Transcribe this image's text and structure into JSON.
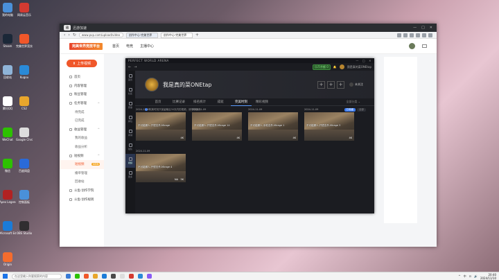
{
  "desktop": {
    "icons": [
      {
        "label": "我的电脑",
        "color": "#4a90d9"
      },
      {
        "label": "网易云音乐",
        "color": "#d33a31"
      },
      {
        "label": "Steam",
        "color": "#1b2838"
      },
      {
        "label": "完美世界竞技平台",
        "color": "#f0572a"
      },
      {
        "label": "回收站",
        "color": "#8fb4d8"
      },
      {
        "label": "Kugou",
        "color": "#2a8ad8"
      },
      {
        "label": "腾讯QQ",
        "color": "#ffffff"
      },
      {
        "label": "CS2",
        "color": "#e8a62c"
      },
      {
        "label": "WeChat",
        "color": "#2dc100"
      },
      {
        "label": "Google Chrome",
        "color": "#dddddd"
      },
      {
        "label": "微信",
        "color": "#2dc100"
      },
      {
        "label": "百度网盘",
        "color": "#2a6ad8"
      },
      {
        "label": "Apex Legends",
        "color": "#b22222"
      },
      {
        "label": "控制面板",
        "color": "#4a90d9"
      },
      {
        "label": "Microsoft Edge",
        "color": "#1b7bd8"
      },
      {
        "label": "OBS Studio",
        "color": "#302e31"
      },
      {
        "label": "Origin",
        "color": "#f56c2d"
      }
    ]
  },
  "browser": {
    "window_title": "迅游加速",
    "url": "www.pvp.com/upload/video",
    "tabs": [
      {
        "label": "创作中心-完美世界",
        "active": true
      },
      {
        "label": "创作中心-完美世界",
        "active": false
      }
    ],
    "new_tab_symbol": "+",
    "back_symbol": "‹",
    "forward_symbol": "›",
    "reload_symbol": "↻",
    "minimize_symbol": "—",
    "maximize_symbol": "□",
    "close_symbol": "✕"
  },
  "site": {
    "logo_text": "完美世界竞技平台",
    "nav": [
      "首页",
      "电竞",
      "主播中心"
    ],
    "upload_label": "上传视频",
    "upload_icon": "⬆",
    "sidebar": [
      {
        "label": "首页",
        "type": "top",
        "active": false
      },
      {
        "label": "内容管理",
        "type": "top",
        "active": false
      },
      {
        "label": "粉丝管理",
        "type": "top",
        "active": false
      },
      {
        "label": "任务管理",
        "type": "group",
        "active": false,
        "chevron": "^"
      },
      {
        "label": "待完成",
        "type": "sub",
        "active": false
      },
      {
        "label": "已完成",
        "type": "sub",
        "active": false
      },
      {
        "label": "收益管理",
        "type": "group",
        "active": false,
        "chevron": "^"
      },
      {
        "label": "我的收益",
        "type": "sub",
        "active": false
      },
      {
        "label": "收益分析",
        "type": "sub",
        "active": false
      },
      {
        "label": "短视频",
        "type": "group",
        "active": false,
        "chevron": "^"
      },
      {
        "label": "短视频",
        "type": "sub",
        "active": true,
        "badge": "NEW"
      },
      {
        "label": "播单管理",
        "type": "sub",
        "active": false
      },
      {
        "label": "回收站",
        "type": "sub",
        "active": false
      },
      {
        "label": "斗鱼·创作学院",
        "type": "top",
        "active": false
      },
      {
        "label": "斗鱼·创作规则",
        "type": "top",
        "active": false
      }
    ]
  },
  "game": {
    "app_title": "PERFECT WORLD ARENA",
    "window_controls": [
      "—",
      "□",
      "✕"
    ],
    "nav_arrows": [
      "←",
      "→"
    ],
    "coin_label": "乐币余额 0",
    "top_username": "我是真的菜ONEtap",
    "left_nav": [
      {
        "label": "首页",
        "active": false
      },
      {
        "label": "社区",
        "active": false
      },
      {
        "label": "赛事",
        "active": false
      },
      {
        "label": "排位",
        "active": false
      },
      {
        "label": "商城",
        "active": false
      },
      {
        "label": "组队",
        "active": false
      },
      {
        "label": "视频",
        "active": true
      },
      {
        "label": "更多",
        "active": false
      }
    ],
    "profile_name": "我是真的菜ONEtap",
    "profile_actions": [
      "+",
      "+",
      "+"
    ],
    "follow_label": "未关注",
    "tabs": [
      {
        "label": "首页",
        "active": false
      },
      {
        "label": "比赛记录",
        "active": false
      },
      {
        "label": "排名统计",
        "active": false
      },
      {
        "label": "成就",
        "active": false
      },
      {
        "label": "完美时刻",
        "active": true
      },
      {
        "label": "精彩视频",
        "active": false
      }
    ],
    "tab_filter": "全部分类 ⌄",
    "notice": "完美时刻只保留最近30天内的视频，请尽快保存",
    "toggle_labels": [
      "已收藏",
      "全部"
    ],
    "clips": [
      {
        "date": "2024-11-09",
        "title": "不可能漏人-开镜击杀-Mirage",
        "res": "4K",
        "duration": ""
      },
      {
        "date": "2024-11-09",
        "title": "不可能漏人-开镜击杀-Mirage 14",
        "res": "4K",
        "duration": ""
      },
      {
        "date": "2024-11-09",
        "title": "不可能漏人-手枪击杀-Mirage 1",
        "res": "4K",
        "duration": ""
      },
      {
        "date": "2024-11-09",
        "title": "不可能漏人-开镜击杀-Mirage 3",
        "res": "4K",
        "duration": ""
      },
      {
        "date": "2024-11-09",
        "title": "不可能漏人-开镜击杀-Mirage 4",
        "res": "5K",
        "duration": "NA"
      }
    ]
  },
  "taskbar": {
    "search_placeholder": "在这里输入你要搜索的内容",
    "apps": [
      "#3a7bd5",
      "#2dc100",
      "#f0572a",
      "#e8a62c",
      "#1b7bd8",
      "#4a4a4a",
      "#dddddd",
      "#d33a31",
      "#2a8ad8",
      "#8a5cf5"
    ],
    "tray": [
      "^",
      "中",
      "⊡",
      "🔊"
    ],
    "time": "20:40",
    "date": "2024/11/10"
  }
}
